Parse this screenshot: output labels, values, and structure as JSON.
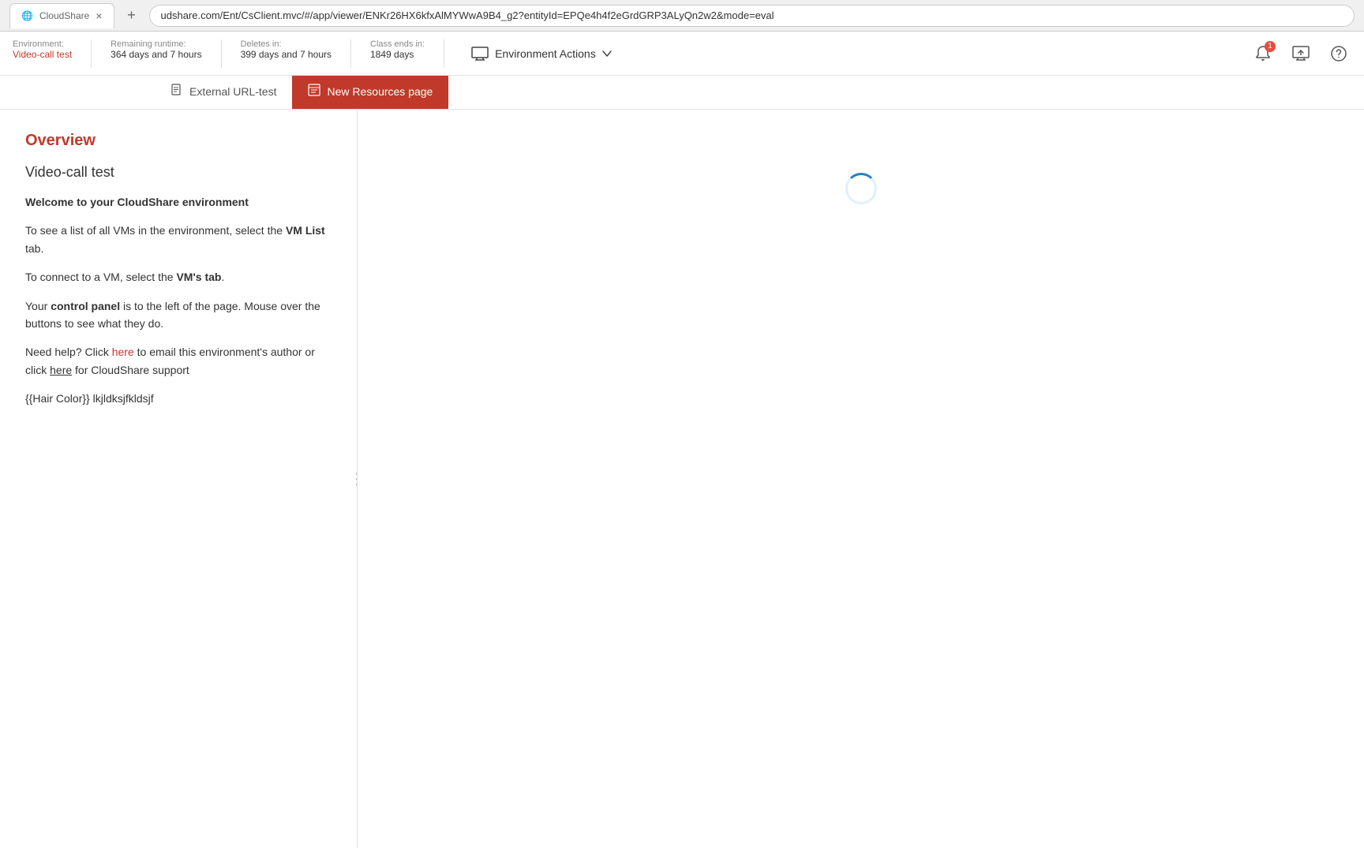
{
  "browser": {
    "tab_title": "",
    "tab_close": "×",
    "tab_new": "+",
    "address": "udshare.com/Ent/CsClient.mvc/#/app/viewer/ENKr26HX6kfxAlMYWwA9B4_g2?entityId=EPQe4h4f2eGrdGRP3ALyQn2w2&mode=eval"
  },
  "header": {
    "environment_label": "Environment:",
    "environment_value": "Video-call test",
    "remaining_label": "Remaining runtime:",
    "remaining_value": "364 days and 7 hours",
    "deletes_label": "Deletes in:",
    "deletes_value": "399 days and 7 hours",
    "class_label": "Class ends in:",
    "class_value": "1849 days",
    "env_actions_label": "Environment Actions",
    "notification_count": "1",
    "icons": {
      "bell": "🔔",
      "monitor": "🖥",
      "help": "?"
    }
  },
  "tabs": [
    {
      "id": "external-url",
      "label": "External URL-test",
      "icon": "📄",
      "active": false
    },
    {
      "id": "new-resources",
      "label": "New Resources page",
      "icon": "📋",
      "active": true
    }
  ],
  "overview": {
    "title": "Overview",
    "env_name": "Video-call test",
    "welcome_heading": "Welcome to your CloudShare environment",
    "paragraph1": "To see a list of all VMs in the environment, select the ",
    "vm_list_bold": "VM List",
    "paragraph1_end": " tab.",
    "paragraph2": "To connect to a VM, select the ",
    "vms_tab_bold": "VM's tab",
    "paragraph2_end": ".",
    "paragraph3_start": "Your ",
    "control_panel_bold": "control panel",
    "paragraph3_end": " is to the left of the page. Mouse over the buttons to see what they do.",
    "paragraph4_start": "Need help? Click ",
    "here1": "here",
    "paragraph4_mid": " to email this environment's author or click ",
    "here2": "here",
    "paragraph4_end": " for CloudShare support",
    "template_text": "{{Hair Color}} lkjldksjfkldsjf"
  },
  "loading": {
    "visible": true
  }
}
